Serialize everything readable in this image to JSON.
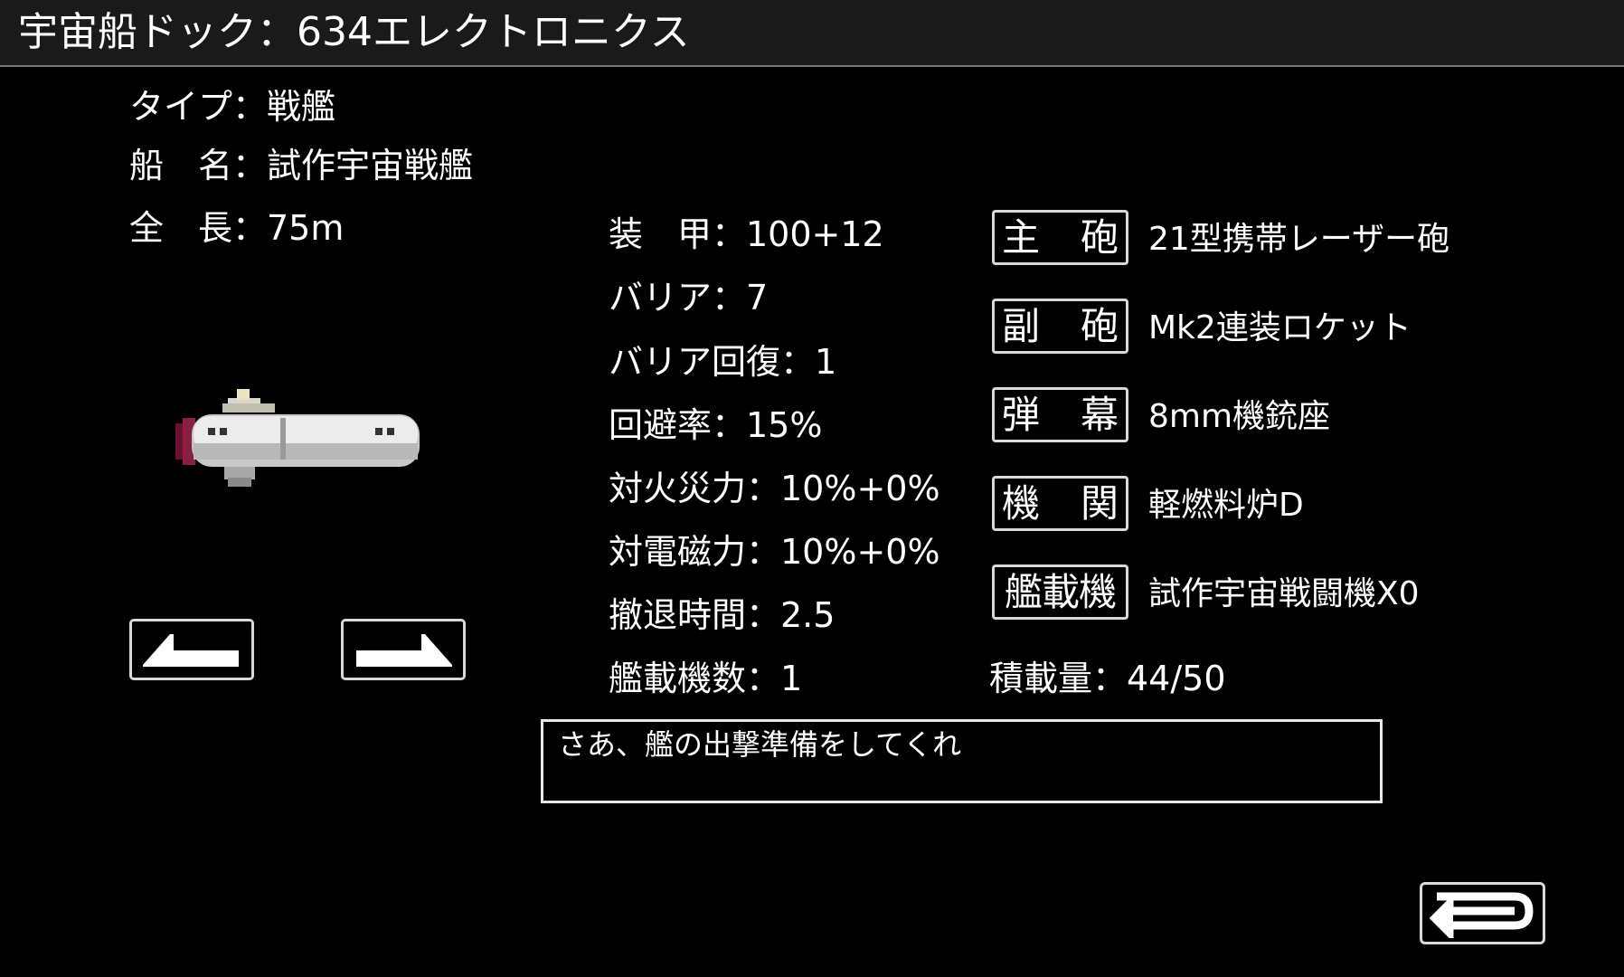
{
  "header": {
    "title": "宇宙船ドック：634エレクトロニクス"
  },
  "ship": {
    "type": "タイプ：戦艦",
    "name": "船　名：試作宇宙戦艦",
    "length": "全　長：75m",
    "sprite_icon": "spaceship-sprite"
  },
  "nav": {
    "prev_icon": "arrow-left-icon",
    "next_icon": "arrow-right-icon"
  },
  "stats": {
    "armor": "装　甲：100+12",
    "barrier": "バリア：7",
    "barrier_recovery": "バリア回復：1",
    "evasion": "回避率：15%",
    "fire_resist": "対火災力：10%+0%",
    "em_resist": "対電磁力：10%+0%",
    "retreat_time": "撤退時間：2.5",
    "carrier_count": "艦載機数：1",
    "load": "積載量：44/50"
  },
  "equipment": {
    "main_gun": {
      "label_a": "主",
      "label_b": "砲",
      "value": "21型携帯レーザー砲"
    },
    "sub_gun": {
      "label_a": "副",
      "label_b": "砲",
      "value": "Mk2連装ロケット"
    },
    "barrage": {
      "label_a": "弾",
      "label_b": "幕",
      "value": "8mm機銃座"
    },
    "engine": {
      "label_a": "機",
      "label_b": "関",
      "value": "軽燃料炉D"
    },
    "aircraft": {
      "label": "艦載機",
      "value": "試作宇宙戦闘機X0"
    }
  },
  "message": {
    "text": "さあ、艦の出撃準備をしてくれ"
  },
  "footer": {
    "return_icon": "return-icon"
  }
}
